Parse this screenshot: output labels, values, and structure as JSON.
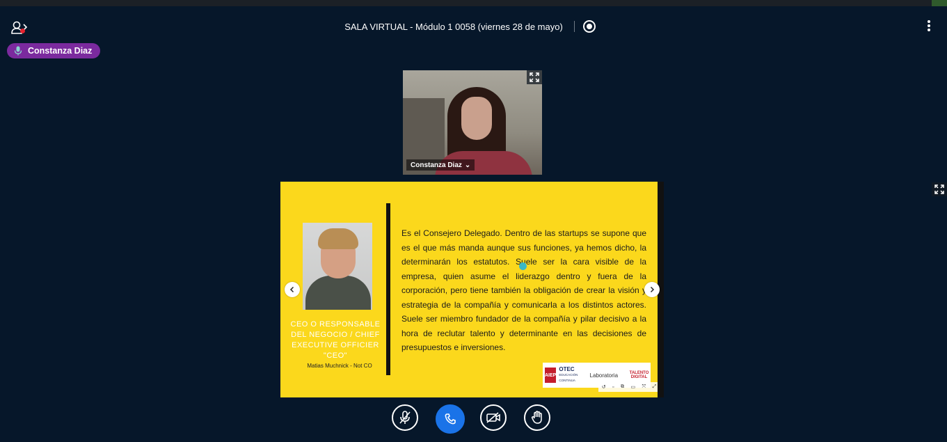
{
  "header": {
    "title": "SALA VIRTUAL - Módulo 1 0058 (viernes 28 de mayo)"
  },
  "talking_indicator": {
    "name": "Constanza Diaz"
  },
  "webcam": {
    "name": "Constanza Diaz"
  },
  "slide": {
    "role": "CEO O RESPONSABLE DEL NEGOCIO / CHIEF EXECUTIVE OFFICIER \"CEO\"",
    "author": "Matias Muchnick - Not CO",
    "body": "Es el Consejero Delegado. Dentro de las startups se supone que es el que más manda aunque sus funciones, ya hemos dicho, la determinarán los estatutos. Suele ser la cara visible de la empresa, quien asume el liderazgo dentro y fuera de la corporación, pero tiene también la obligación de crear la visión y estrategia de la compañía y comunicarla a los distintos actores. Suele ser miembro fundador de la compañía y pilar decisivo a la hora de reclutar talento y determinante en las decisiones de presupuestos e inversiones.",
    "logos": {
      "aiep": "AIEP",
      "otec": "OTEC",
      "otec_sub": "EDUCACIÓN CONTINUA",
      "laboratoria": "Laboratoria",
      "talento": "TALENTO DIGITAL"
    }
  },
  "colors": {
    "background": "#06172a",
    "slide_yellow": "#fbd81c",
    "talking_purple": "#7b2a9e",
    "hangup_blue": "#1a73e8",
    "record_red": "#e3232f"
  },
  "icons": [
    "user-list-icon",
    "record-icon",
    "kebab-menu-icon",
    "microphone-icon",
    "fullscreen-icon",
    "chevron-left-icon",
    "chevron-right-icon",
    "mic-muted-icon",
    "phone-icon",
    "video-off-icon",
    "raise-hand-icon"
  ]
}
